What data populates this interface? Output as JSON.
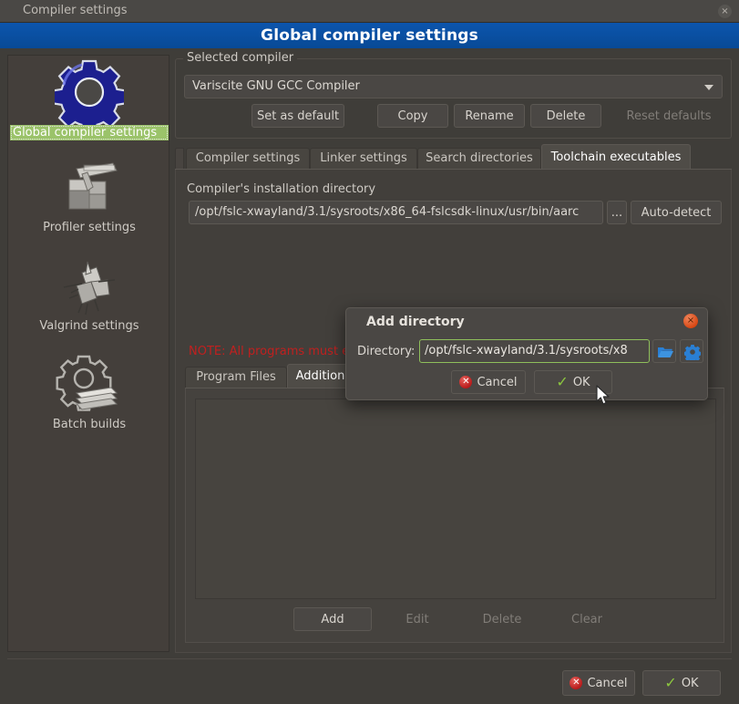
{
  "window": {
    "title": "Compiler settings",
    "close_icon": "close-icon",
    "close_glyph": "×"
  },
  "banner": {
    "title": "Global compiler settings"
  },
  "sidebar": {
    "items": [
      {
        "label": "Global compiler settings",
        "icon": "blue-gear-icon",
        "selected": true
      },
      {
        "label": "Profiler settings",
        "icon": "caliper-blocks-icon",
        "selected": false
      },
      {
        "label": "Valgrind settings",
        "icon": "valgrind-windmill-icon",
        "selected": false
      },
      {
        "label": "Batch builds",
        "icon": "gear-stack-icon",
        "selected": false
      }
    ]
  },
  "selected_compiler": {
    "group_title": "Selected compiler",
    "combo_value": "Variscite GNU GCC Compiler",
    "dropdown_icon": "chevron-down-icon",
    "buttons": [
      {
        "label": "Set as default",
        "enabled": true
      },
      {
        "label": "Copy",
        "enabled": true
      },
      {
        "label": "Rename",
        "enabled": true
      },
      {
        "label": "Delete",
        "enabled": true
      },
      {
        "label": "Reset defaults",
        "enabled": false
      }
    ]
  },
  "tabs": [
    {
      "label": "Compiler settings",
      "active": false
    },
    {
      "label": "Linker settings",
      "active": false
    },
    {
      "label": "Search directories",
      "active": false
    },
    {
      "label": "Toolchain executables",
      "active": true
    }
  ],
  "toolchain": {
    "install_dir_label": "Compiler's installation directory",
    "install_dir_value": "/opt/fslc-xwayland/3.1/sysroots/x86_64-fslcsdk-linux/usr/bin/aarc",
    "browse_label": "...",
    "auto_detect_label": "Auto-detect",
    "note": "NOTE: All programs must exist either in the \"bin\" sub-directory of this path, or in any",
    "note_color": "#c0201f",
    "inner_tabs": [
      {
        "label": "Program Files",
        "active": false
      },
      {
        "label": "Additional Paths",
        "active": true
      }
    ],
    "list_items": [],
    "list_buttons": [
      {
        "label": "Add",
        "enabled": true
      },
      {
        "label": "Edit",
        "enabled": false
      },
      {
        "label": "Delete",
        "enabled": false
      },
      {
        "label": "Clear",
        "enabled": false
      }
    ]
  },
  "footer": {
    "cancel_label": "Cancel",
    "cancel_icon": "cancel-x-icon",
    "ok_label": "OK",
    "ok_icon": "check-icon"
  },
  "modal": {
    "title": "Add directory",
    "close_icon": "close-icon",
    "close_glyph": "×",
    "directory_label": "Directory:",
    "directory_value": "/opt/fslc-xwayland/3.1/sysroots/x8",
    "browse_icon": "folder-open-icon",
    "settings_icon": "gear-icon",
    "cancel_label": "Cancel",
    "cancel_icon": "cancel-x-icon",
    "ok_label": "OK",
    "ok_icon": "check-icon"
  },
  "cursor": {
    "icon": "mouse-pointer-icon"
  },
  "colors": {
    "banner": "#0a4d9e",
    "selection_green": "#9bc36a",
    "note_red": "#c0201f",
    "accent_blue": "#2a7fd4"
  }
}
